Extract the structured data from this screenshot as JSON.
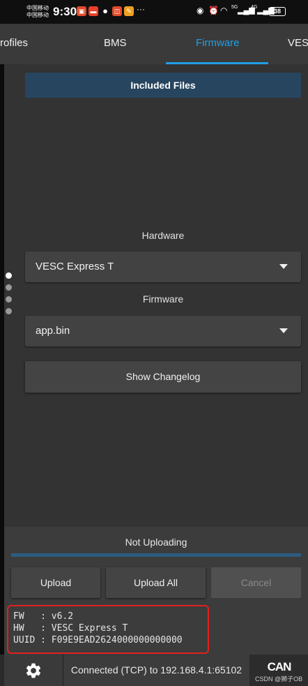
{
  "status_bar": {
    "carrier_1": "中国移动",
    "carrier_2": "中国移动",
    "time": "9:30",
    "more": "···",
    "signal_1": "5G",
    "signal_2": "4G",
    "battery": "38"
  },
  "tabs": [
    {
      "label": "rofiles",
      "active": false
    },
    {
      "label": "BMS",
      "active": false
    },
    {
      "label": "Firmware",
      "active": true
    },
    {
      "label": "VES",
      "active": false
    }
  ],
  "firmware": {
    "included_files_label": "Included Files",
    "hardware_label": "Hardware",
    "hardware_value": "VESC Express T",
    "firmware_label": "Firmware",
    "firmware_value": "app.bin",
    "changelog_label": "Show Changelog"
  },
  "upload": {
    "status": "Not Uploading",
    "upload_label": "Upload",
    "upload_all_label": "Upload All",
    "cancel_label": "Cancel"
  },
  "device_info": {
    "fw": "FW   : v6.2",
    "hw": "HW   : VESC Express T",
    "uuid": "UUID : F09E9EAD2624000000000000"
  },
  "footer": {
    "connection": "Connected (TCP) to 192.168.4.1:65102",
    "can_label": "CAN",
    "watermark": "CSDN @狮子OB"
  },
  "colors": {
    "accent": "#1fa0e6",
    "highlight_border": "#e02020"
  }
}
